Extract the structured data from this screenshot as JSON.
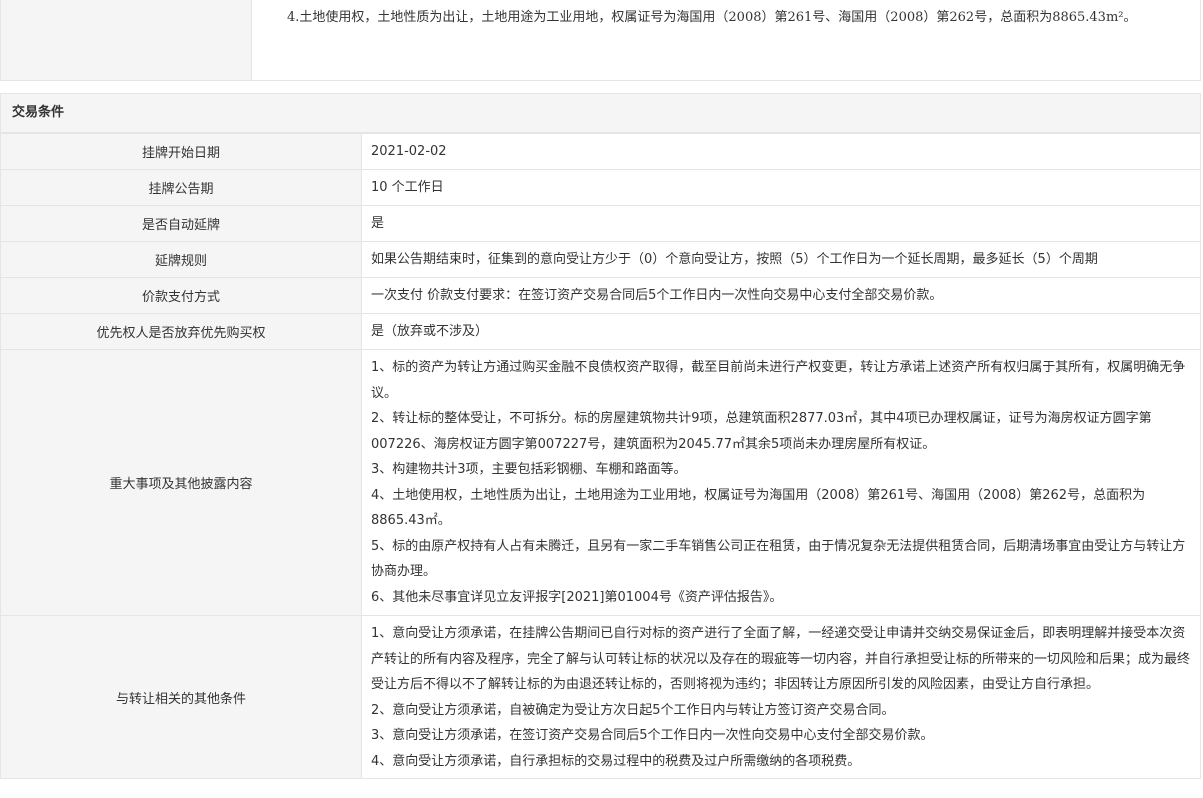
{
  "top": {
    "paragraph": "4.土地使用权，土地性质为出让，土地用途为工业用地，权属证号为海国用（2008）第261号、海国用（2008）第262号，总面积为8865.43m²。"
  },
  "section": {
    "title": "交易条件"
  },
  "rows": {
    "start_date": {
      "label": "挂牌开始日期",
      "value": "2021-02-02"
    },
    "period": {
      "label": "挂牌公告期",
      "value": "10 个工作日"
    },
    "auto_extend": {
      "label": "是否自动延牌",
      "value": "是"
    },
    "extend_rule": {
      "label": "延牌规则",
      "value": "如果公告期结束时，征集到的意向受让方少于（0）个意向受让方，按照（5）个工作日为一个延长周期，最多延长（5）个周期"
    },
    "payment": {
      "label": "价款支付方式",
      "value": "一次支付 价款支付要求：在签订资产交易合同后5个工作日内一次性向交易中心支付全部交易价款。"
    },
    "priority": {
      "label": "优先权人是否放弃优先购买权",
      "value": "是（放弃或不涉及）"
    },
    "disclosure": {
      "label": "重大事项及其他披露内容",
      "lines": [
        "1、标的资产为转让方通过购买金融不良债权资产取得，截至目前尚未进行产权变更，转让方承诺上述资产所有权归属于其所有，权属明确无争议。",
        "2、转让标的整体受让，不可拆分。标的房屋建筑物共计9项，总建筑面积2877.03㎡，其中4项已办理权属证，证号为海房权证方圆字第007226、海房权证方圆字第007227号，建筑面积为2045.77㎡其余5项尚未办理房屋所有权证。",
        "3、构建物共计3项，主要包括彩钢棚、车棚和路面等。",
        "4、土地使用权，土地性质为出让，土地用途为工业用地，权属证号为海国用（2008）第261号、海国用（2008）第262号，总面积为8865.43㎡。",
        "5、标的由原产权持有人占有未腾迁，且另有一家二手车销售公司正在租赁，由于情况复杂无法提供租赁合同，后期清场事宜由受让方与转让方协商办理。",
        "6、其他未尽事宜详见立友评报字[2021]第01004号《资产评估报告》。"
      ]
    },
    "other_conditions": {
      "label": "与转让相关的其他条件",
      "lines": [
        "1、意向受让方须承诺，在挂牌公告期间已自行对标的资产进行了全面了解，一经递交受让申请并交纳交易保证金后，即表明理解并接受本次资产转让的所有内容及程序，完全了解与认可转让标的状况以及存在的瑕疵等一切内容，并自行承担受让标的所带来的一切风险和后果；成为最终受让方后不得以不了解转让标的为由退还转让标的，否则将视为违约；非因转让方原因所引发的风险因素，由受让方自行承担。",
        "2、意向受让方须承诺，自被确定为受让方次日起5个工作日内与转让方签订资产交易合同。",
        "3、意向受让方须承诺，在签订资产交易合同后5个工作日内一次性向交易中心支付全部交易价款。",
        "4、意向受让方须承诺，自行承担标的交易过程中的税费及过户所需缴纳的各项税费。"
      ]
    }
  }
}
